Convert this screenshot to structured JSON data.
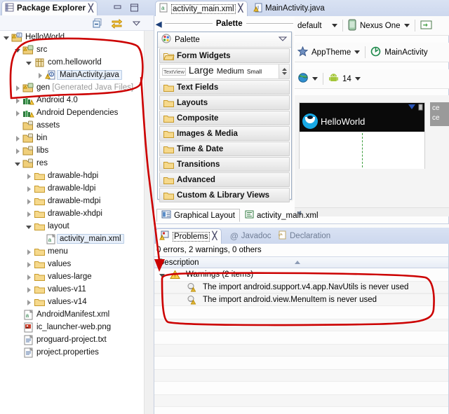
{
  "window": {
    "app": "Eclipse IDE",
    "accent_blue": "#cdd8ee",
    "annotation_red": "#cc0000"
  },
  "package_explorer": {
    "tab_label": "Package Explorer",
    "close_icon": "close-icon",
    "minimize_icon": "minimize-icon",
    "maximize_icon": "maximize-icon",
    "toolbar": {
      "collapse_all_icon": "collapse-all-icon",
      "link_with_editor_icon": "link-with-editor-icon",
      "view_menu_icon": "view-menu-icon"
    },
    "tree": [
      {
        "label": "HelloWorld",
        "indent": 0,
        "twisty": "open",
        "icon": "java-project-icon",
        "selected": false,
        "suffix": ""
      },
      {
        "label": "src",
        "indent": 1,
        "twisty": "open",
        "icon": "source-folder-icon",
        "selected": false,
        "suffix": ""
      },
      {
        "label": "com.helloworld",
        "indent": 2,
        "twisty": "open",
        "icon": "package-icon",
        "selected": false,
        "suffix": ""
      },
      {
        "label": "MainActivity.java",
        "indent": 3,
        "twisty": "closed",
        "icon": "java-file-warning-icon",
        "selected": true,
        "suffix": ""
      },
      {
        "label": "gen ",
        "indent": 1,
        "twisty": "closed",
        "icon": "source-folder-icon",
        "selected": false,
        "suffix": "[Generated Java Files]"
      },
      {
        "label": "Android 4.0",
        "indent": 1,
        "twisty": "closed",
        "icon": "library-icon",
        "selected": false,
        "suffix": ""
      },
      {
        "label": "Android Dependencies",
        "indent": 1,
        "twisty": "closed",
        "icon": "library-icon",
        "selected": false,
        "suffix": ""
      },
      {
        "label": "assets",
        "indent": 1,
        "twisty": "none",
        "icon": "folder-res-icon",
        "selected": false,
        "suffix": ""
      },
      {
        "label": "bin",
        "indent": 1,
        "twisty": "closed",
        "icon": "folder-res-icon",
        "selected": false,
        "suffix": ""
      },
      {
        "label": "libs",
        "indent": 1,
        "twisty": "closed",
        "icon": "folder-res-icon",
        "selected": false,
        "suffix": ""
      },
      {
        "label": "res",
        "indent": 1,
        "twisty": "open",
        "icon": "folder-res-icon",
        "selected": false,
        "suffix": ""
      },
      {
        "label": "drawable-hdpi",
        "indent": 2,
        "twisty": "closed",
        "icon": "folder-icon",
        "selected": false,
        "suffix": ""
      },
      {
        "label": "drawable-ldpi",
        "indent": 2,
        "twisty": "closed",
        "icon": "folder-icon",
        "selected": false,
        "suffix": ""
      },
      {
        "label": "drawable-mdpi",
        "indent": 2,
        "twisty": "closed",
        "icon": "folder-icon",
        "selected": false,
        "suffix": ""
      },
      {
        "label": "drawable-xhdpi",
        "indent": 2,
        "twisty": "closed",
        "icon": "folder-icon",
        "selected": false,
        "suffix": ""
      },
      {
        "label": "layout",
        "indent": 2,
        "twisty": "open",
        "icon": "folder-icon",
        "selected": false,
        "suffix": ""
      },
      {
        "label": "activity_main.xml",
        "indent": 3,
        "twisty": "none",
        "icon": "xml-file-icon",
        "selected": true,
        "suffix": ""
      },
      {
        "label": "menu",
        "indent": 2,
        "twisty": "closed",
        "icon": "folder-icon",
        "selected": false,
        "suffix": ""
      },
      {
        "label": "values",
        "indent": 2,
        "twisty": "closed",
        "icon": "folder-icon",
        "selected": false,
        "suffix": ""
      },
      {
        "label": "values-large",
        "indent": 2,
        "twisty": "closed",
        "icon": "folder-icon",
        "selected": false,
        "suffix": ""
      },
      {
        "label": "values-v11",
        "indent": 2,
        "twisty": "closed",
        "icon": "folder-icon",
        "selected": false,
        "suffix": ""
      },
      {
        "label": "values-v14",
        "indent": 2,
        "twisty": "closed",
        "icon": "folder-icon",
        "selected": false,
        "suffix": ""
      },
      {
        "label": "AndroidManifest.xml",
        "indent": 1,
        "twisty": "none",
        "icon": "xml-file-icon",
        "selected": false,
        "suffix": ""
      },
      {
        "label": "ic_launcher-web.png",
        "indent": 1,
        "twisty": "none",
        "icon": "image-file-icon",
        "selected": false,
        "suffix": ""
      },
      {
        "label": "proguard-project.txt",
        "indent": 1,
        "twisty": "none",
        "icon": "text-file-icon",
        "selected": false,
        "suffix": ""
      },
      {
        "label": "project.properties",
        "indent": 1,
        "twisty": "none",
        "icon": "text-file-icon",
        "selected": false,
        "suffix": ""
      }
    ]
  },
  "editor": {
    "tabs": [
      {
        "label": "activity_main.xml",
        "icon": "xml-file-icon",
        "active": true,
        "closable": true
      },
      {
        "label": "MainActivity.java",
        "icon": "java-file-warning-icon",
        "active": false,
        "closable": false
      }
    ],
    "palette": {
      "header_label": "Palette",
      "box_title": "Palette",
      "collapse_icon": "chevron-down-icon",
      "back_icon": "chevron-left-icon",
      "widget_samples": {
        "textview": "TextView",
        "large": "Large",
        "medium": "Medium",
        "small": "Small"
      },
      "groups": [
        {
          "label": "Form Widgets",
          "icon": "folder-open-icon"
        },
        {
          "label": "Text Fields",
          "icon": "folder-icon"
        },
        {
          "label": "Layouts",
          "icon": "folder-icon"
        },
        {
          "label": "Composite",
          "icon": "folder-icon"
        },
        {
          "label": "Images & Media",
          "icon": "folder-icon"
        },
        {
          "label": "Time & Date",
          "icon": "folder-icon"
        },
        {
          "label": "Transitions",
          "icon": "folder-icon"
        },
        {
          "label": "Advanced",
          "icon": "folder-icon"
        },
        {
          "label": "Custom & Library Views",
          "icon": "folder-icon"
        }
      ]
    },
    "config": {
      "config_selected": "default",
      "device_selected": "Nexus One",
      "orientation_icon": "orientation-icon",
      "theme_selected": "AppTheme",
      "theme_icon": "star-icon",
      "activity_selected": "MainActivity",
      "activity_icon": "activity-icon",
      "locale_icon": "globe-icon",
      "api_level": "14",
      "android_icon": "android-icon",
      "zoom_fit_width_icon": "fit-width-icon",
      "zoom_fit_height_icon": "fit-height-icon",
      "show_outline_icon": "outline-icon",
      "zoom_out_icon": "zoom-out-icon",
      "zoom_fit_icon": "zoom-fit-icon",
      "zoom_actual_icon": "zoom-actual-icon",
      "zoom_minus_icon": "zoom-minus-icon"
    },
    "preview": {
      "app_title": "HelloWorld",
      "app_icon": "app-launcher-icon",
      "tooltip_line1": "ce",
      "tooltip_line2": "ce",
      "scroll_left_icon": "scroll-left-icon"
    },
    "subtabs": [
      {
        "label": "Graphical Layout",
        "icon": "graphical-layout-icon",
        "active": true
      },
      {
        "label": "activity_main.xml",
        "icon": "xml-editor-icon",
        "active": false
      }
    ]
  },
  "problems": {
    "tabs": [
      {
        "label": "Problems",
        "icon": "problems-icon",
        "active": true,
        "closable": true
      },
      {
        "label": "Javadoc",
        "icon": "javadoc-icon",
        "active": false,
        "closable": false
      },
      {
        "label": "Declaration",
        "icon": "declaration-icon",
        "active": false,
        "closable": false
      }
    ],
    "summary": "0 errors, 2 warnings, 0 others",
    "column_header": "Description",
    "sort_indicator_icon": "sort-ascending-icon",
    "rows": [
      {
        "label": "Warnings (2 items)",
        "indent": 0,
        "twisty": "open",
        "icon": "warning-icon"
      },
      {
        "label": "The import android.support.v4.app.NavUtils is never used",
        "indent": 1,
        "twisty": "none",
        "icon": "warning-marker-icon"
      },
      {
        "label": "The import android.view.MenuItem is never used",
        "indent": 1,
        "twisty": "none",
        "icon": "warning-marker-icon"
      }
    ]
  },
  "annotations": {
    "ellipse_tree_label": "highlight-package-tree",
    "ellipse_problems_label": "highlight-warnings",
    "arrow_label": "pointer-arrow"
  }
}
